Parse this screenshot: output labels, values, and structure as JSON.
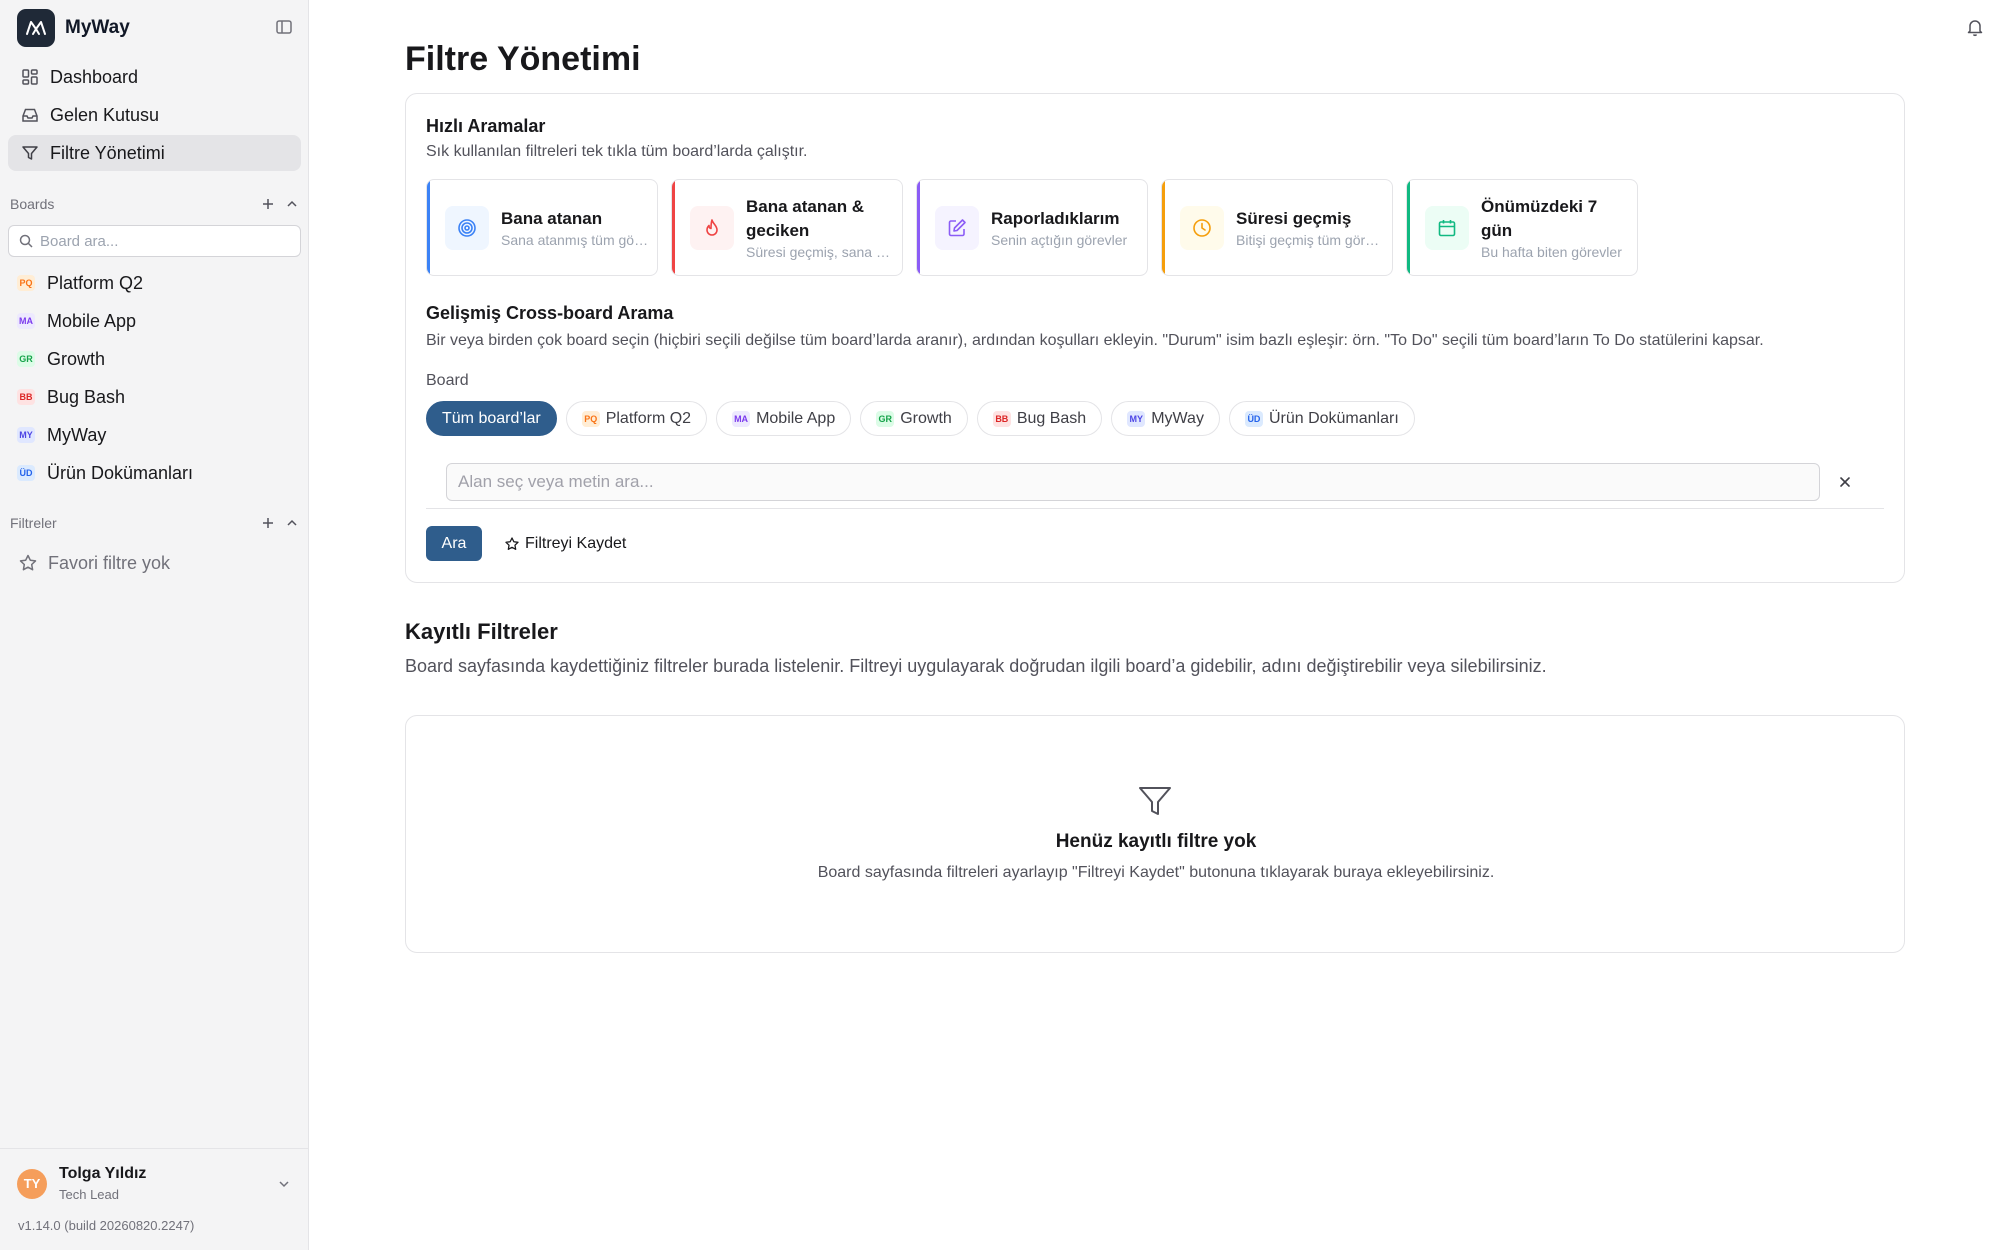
{
  "app": {
    "name": "MyWay",
    "version": "v1.14.0 (build 20260820.2247)"
  },
  "sidebar": {
    "nav": [
      {
        "label": "Dashboard",
        "icon": "dashboard-icon"
      },
      {
        "label": "Gelen Kutusu",
        "icon": "inbox-icon"
      },
      {
        "label": "Filtre Yönetimi",
        "icon": "filter-icon",
        "active": true
      }
    ],
    "boards_heading": "Boards",
    "board_search_placeholder": "Board ara...",
    "boards": [
      {
        "abbr": "PQ",
        "label": "Platform Q2",
        "color": "#f97316",
        "bg": "#ffedd5"
      },
      {
        "abbr": "MA",
        "label": "Mobile App",
        "color": "#7c3aed",
        "bg": "#ede9fe"
      },
      {
        "abbr": "GR",
        "label": "Growth",
        "color": "#16a34a",
        "bg": "#dcfce7"
      },
      {
        "abbr": "BB",
        "label": "Bug Bash",
        "color": "#dc2626",
        "bg": "#fee2e2"
      },
      {
        "abbr": "MY",
        "label": "MyWay",
        "color": "#4f46e5",
        "bg": "#e0e7ff"
      },
      {
        "abbr": "ÜD",
        "label": "Ürün Dokümanları",
        "color": "#2563eb",
        "bg": "#dbeafe"
      }
    ],
    "filters_heading": "Filtreler",
    "favorites_empty": "Favori filtre yok",
    "user": {
      "initials": "TY",
      "name": "Tolga Yıldız",
      "role": "Tech Lead"
    }
  },
  "main": {
    "title": "Filtre Yönetimi",
    "quick": {
      "title": "Hızlı Aramalar",
      "desc": "Sık kullanılan filtreleri tek tıkla tüm board’larda çalıştır.",
      "items": [
        {
          "title": "Bana atanan",
          "desc": "Sana atanmış tüm görevler",
          "icon": "target-icon",
          "accent": "#3b82f6",
          "bg": "#eff6ff"
        },
        {
          "title": "Bana atanan & geciken",
          "desc": "Süresi geçmiş, sana atanmış",
          "icon": "flame-icon",
          "accent": "#ef4444",
          "bg": "#fef2f2"
        },
        {
          "title": "Raporladıklarım",
          "desc": "Senin açtığın görevler",
          "icon": "edit-icon",
          "accent": "#8b5cf6",
          "bg": "#f5f3ff"
        },
        {
          "title": "Süresi geçmiş",
          "desc": "Bitişi geçmiş tüm görevler",
          "icon": "clock-icon",
          "accent": "#f59e0b",
          "bg": "#fffbeb"
        },
        {
          "title": "Önümüzdeki 7 gün",
          "desc": "Bu hafta biten görevler",
          "icon": "calendar-icon",
          "accent": "#10b981",
          "bg": "#ecfdf5"
        }
      ]
    },
    "advanced": {
      "title": "Gelişmiş Cross-board Arama",
      "desc": "Bir veya birden çok board seçin (hiçbiri seçili değilse tüm board’larda aranır), ardından koşulları ekleyin. \"Durum\" isim bazlı eşleşir: örn. \"To Do\" seçili tüm board’ların To Do statülerini kapsar.",
      "board_label": "Board",
      "all_boards": "Tüm board’lar",
      "query_placeholder": "Alan seç veya metin ara...",
      "query_value": "",
      "search_button": "Ara",
      "save_button": "Filtreyi Kaydet"
    },
    "saved": {
      "title": "Kayıtlı Filtreler",
      "desc": "Board sayfasında kaydettiğiniz filtreler burada listelenir. Filtreyi uygulayarak doğrudan ilgili board’a gidebilir, adını değiştirebilir veya silebilirsiniz.",
      "empty_title": "Henüz kayıtlı filtre yok",
      "empty_desc": "Board sayfasında filtreleri ayarlayıp \"Filtreyi Kaydet\" butonuna tıklayarak buraya ekleyebilirsiniz."
    }
  }
}
